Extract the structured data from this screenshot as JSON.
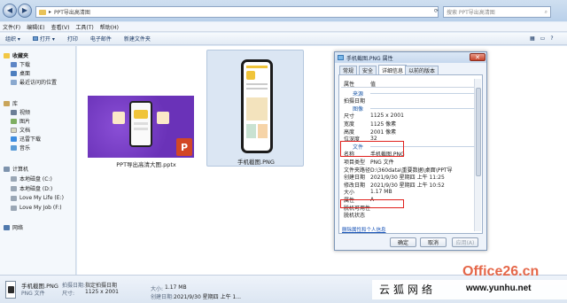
{
  "window": {
    "breadcrumb": "PPT导出高清图",
    "search_placeholder": "搜索 PPT导出高清图"
  },
  "menu": [
    "文件(F)",
    "编辑(E)",
    "查看(V)",
    "工具(T)",
    "帮助(H)"
  ],
  "toolbar": [
    "组织 ▾",
    "打开 ▾",
    "打印",
    "电子邮件",
    "新建文件夹"
  ],
  "sidebar": {
    "favorites": "收藏夹",
    "fav_items": [
      "下载",
      "桌面",
      "最近访问的位置"
    ],
    "libraries": "库",
    "lib_items": [
      "视频",
      "图片",
      "文档",
      "迅雷下载",
      "音乐"
    ],
    "computer": "计算机",
    "drives": [
      "本地磁盘 (C:)",
      "本地磁盘 (D:)",
      "Love My Life (E:)",
      "Love My Job (F:)"
    ],
    "network": "网络"
  },
  "files": [
    {
      "name": "PPT导出高清大图.pptx"
    },
    {
      "name": "手机截图.PNG"
    }
  ],
  "dialog": {
    "title": "手机截图.PNG 属性",
    "tabs": [
      "常规",
      "安全",
      "详细信息",
      "以前的版本"
    ],
    "col_property": "属性",
    "col_value": "值",
    "rows": [
      {
        "n": "来源",
        "v": "",
        "section": true
      },
      {
        "n": "拍摄日期",
        "v": ""
      },
      {
        "n": "图像",
        "v": "",
        "section": true
      },
      {
        "n": "尺寸",
        "v": "1125 x 2001"
      },
      {
        "n": "宽度",
        "v": "1125 像素"
      },
      {
        "n": "高度",
        "v": "2001 像素"
      },
      {
        "n": "位深度",
        "v": "32"
      },
      {
        "n": "文件",
        "v": "",
        "section": true
      },
      {
        "n": "名称",
        "v": "手机截图.PNG"
      },
      {
        "n": "项目类型",
        "v": "PNG 文件"
      },
      {
        "n": "文件夹路径",
        "v": "D:\\360data\\重要数据\\桌面\\PPT导"
      },
      {
        "n": "创建日期",
        "v": "2021/9/30 星期四 上午 11:25"
      },
      {
        "n": "修改日期",
        "v": "2021/9/30 星期四 上午 10:52"
      },
      {
        "n": "大小",
        "v": "1.17 MB"
      },
      {
        "n": "属性",
        "v": "A"
      },
      {
        "n": "脱机可用性",
        "v": ""
      },
      {
        "n": "脱机状态",
        "v": ""
      }
    ],
    "remove_link": "删除属性和个人信息",
    "buttons": [
      "确定",
      "取消",
      "应用(A)"
    ]
  },
  "status": {
    "filename": "手机截图.PNG",
    "date_label": "拍摄日期:",
    "date_value": "指定拍摄日期",
    "type": "PNG 文件",
    "dim_label": "尺寸:",
    "dim_value": "1125 x 2001",
    "size_label": "大小:",
    "size_value": "1.17 MB",
    "created_label": "创建日期:",
    "created_value": "2021/9/30 星期四 上午 1..."
  },
  "watermark": {
    "brand": "Office26.cn",
    "cn_text": "云狐网络",
    "url": "www.yunhu.net"
  }
}
